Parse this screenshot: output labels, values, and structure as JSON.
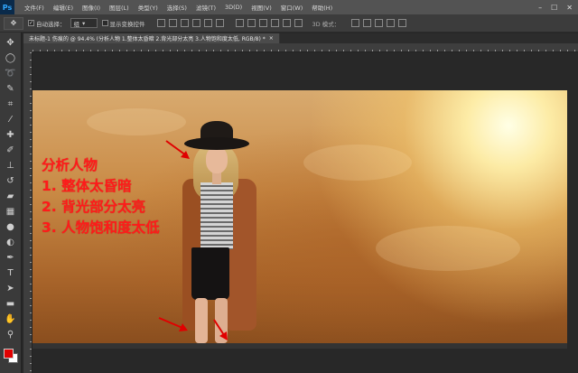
{
  "app": {
    "logo": "Ps"
  },
  "menu": [
    "文件(F)",
    "编辑(E)",
    "图像(I)",
    "图层(L)",
    "类型(Y)",
    "选择(S)",
    "滤镜(T)",
    "3D(D)",
    "视图(V)",
    "窗口(W)",
    "帮助(H)"
  ],
  "window_controls": {
    "minimize": "–",
    "maximize": "☐",
    "close": "✕"
  },
  "options": {
    "auto_select_label": "自动选择：",
    "auto_select_value": "组",
    "show_transform_label": "显示变换控件",
    "mode_3d": "3D 模式："
  },
  "tabs": [
    {
      "label": "未标题-1 伤痕的 @ 94.4% (分析人物 1.整体太昏暗 2.背光部分太亮 3.人物饱和度太低, RGB/8) *",
      "close": "×"
    }
  ],
  "annotation": {
    "title": "分析人物",
    "lines": [
      "1. 整体太昏暗",
      "2. 背光部分太亮",
      "3. 人物饱和度太低"
    ]
  },
  "colors": {
    "foreground": "#e00000",
    "background": "#ffffff",
    "annotation": "#ff1a1a"
  }
}
